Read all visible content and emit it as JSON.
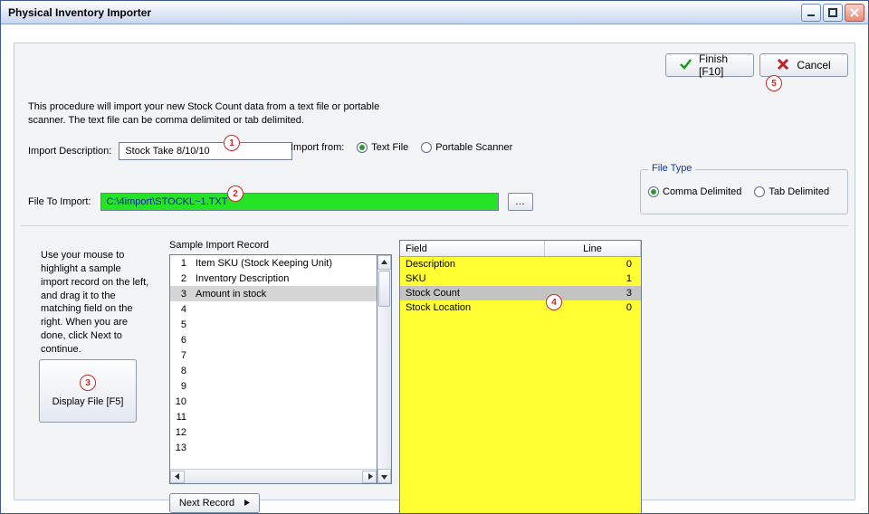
{
  "window": {
    "title": "Physical Inventory Importer"
  },
  "buttons": {
    "finish": "Finish [F10]",
    "cancel": "Cancel"
  },
  "intro": "This procedure will import your new Stock Count data from a text file or portable scanner.  The text file can be comma delimited or tab delimited.",
  "labels": {
    "import_description": "Import Description:",
    "import_from": "Import from:",
    "file_to_import": "File To Import:",
    "file_type": "File Type",
    "sample_import": "Sample Import Record",
    "display_file": "Display File [F5]",
    "next_record": "Next Record",
    "field": "Field",
    "line": "Line"
  },
  "inputs": {
    "import_description": "Stock Take 8/10/10",
    "file_to_import": "C:\\4import\\STOCKL~1.TXT"
  },
  "import_from": {
    "options": {
      "text_file": "Text File",
      "portable_scanner": "Portable Scanner"
    },
    "selected": "text_file"
  },
  "file_type": {
    "options": {
      "comma": "Comma Delimited",
      "tab": "Tab Delimited"
    },
    "selected": "comma"
  },
  "hint": "Use your mouse to highlight a sample import record on the left, and drag it to the matching field on the right.  When you are done, click Next to continue.",
  "sample_rows": {
    "1": "Item SKU (Stock Keeping Unit)",
    "2": "Inventory Description",
    "3": "Amount in stock",
    "4": "",
    "5": "",
    "6": "",
    "7": "",
    "8": "",
    "9": "",
    "10": "",
    "11": "",
    "12": "",
    "13": ""
  },
  "sample_selected_index": 3,
  "field_map": [
    {
      "field": "Description",
      "line": "0"
    },
    {
      "field": "SKU",
      "line": "1"
    },
    {
      "field": "Stock Count",
      "line": "3"
    },
    {
      "field": "Stock Location",
      "line": "0"
    }
  ],
  "field_selected_index": 2,
  "badges": {
    "b1": "1",
    "b2": "2",
    "b3": "3",
    "b4": "4",
    "b5": "5"
  }
}
